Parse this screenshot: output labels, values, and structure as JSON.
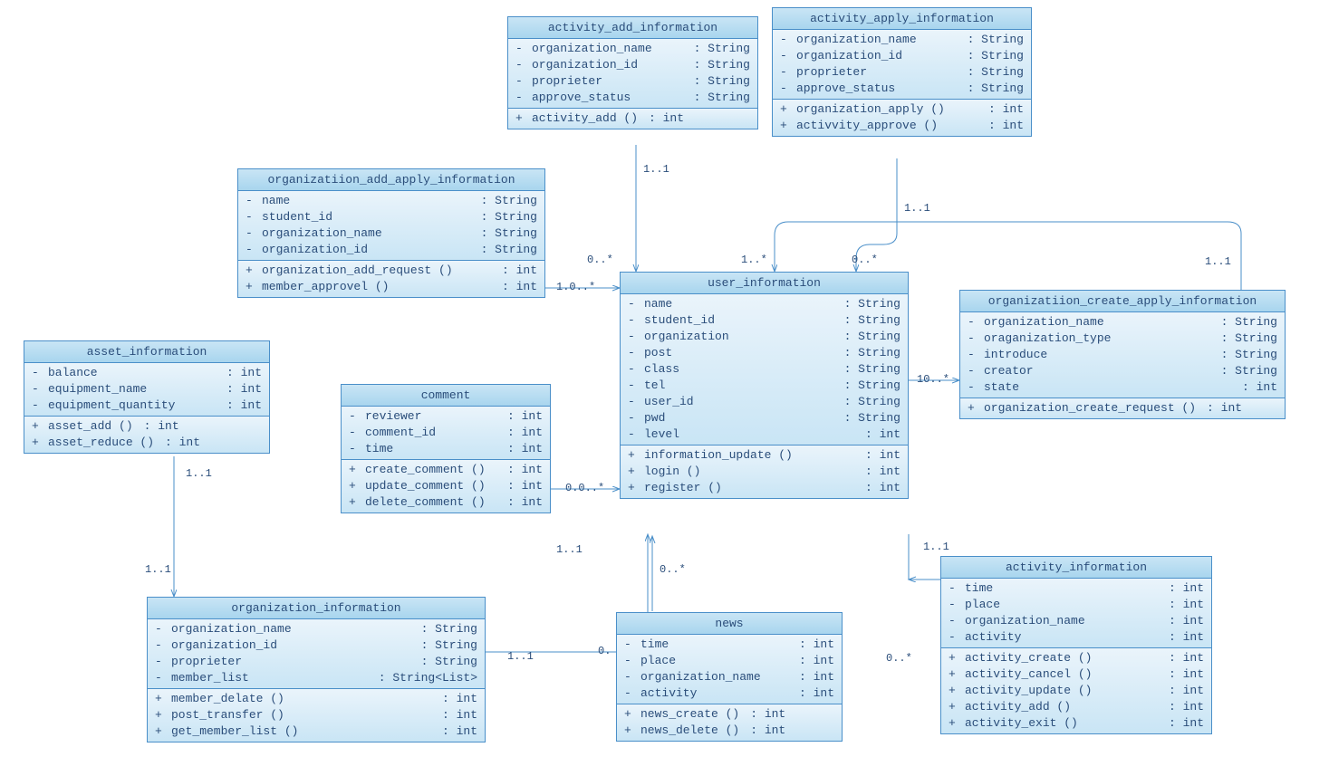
{
  "classes": {
    "activity_add_information": {
      "title": "activity_add_information",
      "attrs": [
        {
          "vis": "-",
          "name": "organization_name",
          "type": ": String"
        },
        {
          "vis": "-",
          "name": "organization_id",
          "type": ": String"
        },
        {
          "vis": "-",
          "name": "proprieter",
          "type": ": String"
        },
        {
          "vis": "-",
          "name": "approve_status",
          "type": ": String"
        }
      ],
      "ops": [
        {
          "vis": "+",
          "name": "activity_add ()",
          "type": ": int"
        }
      ]
    },
    "activity_apply_information": {
      "title": "activity_apply_information",
      "attrs": [
        {
          "vis": "-",
          "name": "organization_name",
          "type": ": String"
        },
        {
          "vis": "-",
          "name": "organization_id",
          "type": ": String"
        },
        {
          "vis": "-",
          "name": "proprieter",
          "type": ": String"
        },
        {
          "vis": "-",
          "name": "approve_status",
          "type": ": String"
        }
      ],
      "ops": [
        {
          "vis": "+",
          "name": "organization_apply ()",
          "type": ": int"
        },
        {
          "vis": "+",
          "name": "activvity_approve ()",
          "type": ": int"
        }
      ]
    },
    "organizatiion_add_apply_information": {
      "title": "organizatiion_add_apply_information",
      "attrs": [
        {
          "vis": "-",
          "name": "name",
          "type": ": String"
        },
        {
          "vis": "-",
          "name": "student_id",
          "type": ": String"
        },
        {
          "vis": "-",
          "name": "organization_name",
          "type": ": String"
        },
        {
          "vis": "-",
          "name": "organization_id",
          "type": ": String"
        }
      ],
      "ops": [
        {
          "vis": "+",
          "name": "organization_add_request ()",
          "type": ": int"
        },
        {
          "vis": "+",
          "name": "member_approvel ()",
          "type": ": int"
        }
      ]
    },
    "asset_information": {
      "title": "asset_information",
      "attrs": [
        {
          "vis": "-",
          "name": "balance",
          "type": ": int"
        },
        {
          "vis": "-",
          "name": "equipment_name",
          "type": ": int"
        },
        {
          "vis": "-",
          "name": "equipment_quantity",
          "type": ": int"
        }
      ],
      "ops": [
        {
          "vis": "+",
          "name": "asset_add ()",
          "type": ": int"
        },
        {
          "vis": "+",
          "name": "asset_reduce ()",
          "type": ": int"
        }
      ]
    },
    "comment": {
      "title": "comment",
      "attrs": [
        {
          "vis": "-",
          "name": "reviewer",
          "type": ": int"
        },
        {
          "vis": "-",
          "name": "comment_id",
          "type": ": int"
        },
        {
          "vis": "-",
          "name": "time",
          "type": ": int"
        }
      ],
      "ops": [
        {
          "vis": "+",
          "name": "create_comment ()",
          "type": ": int"
        },
        {
          "vis": "+",
          "name": "update_comment ()",
          "type": ": int"
        },
        {
          "vis": "+",
          "name": "delete_comment ()",
          "type": ": int"
        }
      ]
    },
    "user_information": {
      "title": "user_information",
      "attrs": [
        {
          "vis": "-",
          "name": "name",
          "type": ": String"
        },
        {
          "vis": "-",
          "name": "student_id",
          "type": ": String"
        },
        {
          "vis": "-",
          "name": "organization",
          "type": ": String"
        },
        {
          "vis": "-",
          "name": "post",
          "type": ": String"
        },
        {
          "vis": "-",
          "name": "class",
          "type": ": String"
        },
        {
          "vis": "-",
          "name": "tel",
          "type": ": String"
        },
        {
          "vis": "-",
          "name": "user_id",
          "type": ": String"
        },
        {
          "vis": "-",
          "name": "pwd",
          "type": ": String"
        },
        {
          "vis": "-",
          "name": "level",
          "type": ": int"
        }
      ],
      "ops": [
        {
          "vis": "+",
          "name": "information_update ()",
          "type": ": int"
        },
        {
          "vis": "+",
          "name": "login ()",
          "type": ": int"
        },
        {
          "vis": "+",
          "name": "register ()",
          "type": ": int"
        }
      ]
    },
    "organizatiion_create_apply_information": {
      "title": "organizatiion_create_apply_information",
      "attrs": [
        {
          "vis": "-",
          "name": "organization_name",
          "type": ": String"
        },
        {
          "vis": "-",
          "name": "oraganization_type",
          "type": ": String"
        },
        {
          "vis": "-",
          "name": "introduce",
          "type": ": String"
        },
        {
          "vis": "-",
          "name": "creator",
          "type": ": String"
        },
        {
          "vis": "-",
          "name": "state",
          "type": ": int"
        }
      ],
      "ops": [
        {
          "vis": "+",
          "name": "organization_create_request ()",
          "type": ": int"
        }
      ]
    },
    "organization_information": {
      "title": "organization_information",
      "attrs": [
        {
          "vis": "-",
          "name": "organization_name",
          "type": ": String"
        },
        {
          "vis": "-",
          "name": "organization_id",
          "type": ": String"
        },
        {
          "vis": "-",
          "name": "proprieter",
          "type": ": String"
        },
        {
          "vis": "-",
          "name": "member_list",
          "type": ": String<List>"
        }
      ],
      "ops": [
        {
          "vis": "+",
          "name": "member_delate ()",
          "type": ": int"
        },
        {
          "vis": "+",
          "name": "post_transfer ()",
          "type": ": int"
        },
        {
          "vis": "+",
          "name": "get_member_list ()",
          "type": ": int"
        }
      ]
    },
    "news": {
      "title": "news",
      "attrs": [
        {
          "vis": "-",
          "name": "time",
          "type": ": int"
        },
        {
          "vis": "-",
          "name": "place",
          "type": ": int"
        },
        {
          "vis": "-",
          "name": "organization_name",
          "type": ": int"
        },
        {
          "vis": "-",
          "name": "activity",
          "type": ": int"
        }
      ],
      "ops": [
        {
          "vis": "+",
          "name": "news_create ()",
          "type": ": int"
        },
        {
          "vis": "+",
          "name": "news_delete ()",
          "type": ": int"
        }
      ]
    },
    "activity_information": {
      "title": "activity_information",
      "attrs": [
        {
          "vis": "-",
          "name": "time",
          "type": ": int"
        },
        {
          "vis": "-",
          "name": "place",
          "type": ": int"
        },
        {
          "vis": "-",
          "name": "organization_name",
          "type": ": int"
        },
        {
          "vis": "-",
          "name": "activity",
          "type": ": int"
        }
      ],
      "ops": [
        {
          "vis": "+",
          "name": "activity_create ()",
          "type": ": int"
        },
        {
          "vis": "+",
          "name": "activity_cancel ()",
          "type": ": int"
        },
        {
          "vis": "+",
          "name": "activity_update ()",
          "type": ": int"
        },
        {
          "vis": "+",
          "name": "activity_add ()",
          "type": ": int"
        },
        {
          "vis": "+",
          "name": "activity_exit ()",
          "type": ": int"
        }
      ]
    }
  },
  "mults": {
    "m1": "1..1",
    "m2": "0..*",
    "m3": "1..*",
    "m4": "1.0..*",
    "m5": "0.0..*",
    "m6": "10..*",
    "m7": "0.",
    "m8": "1..1",
    "m9": "1..1",
    "m10": "1..1",
    "m11": "1..1",
    "m12": "0..*",
    "m13": "1..1",
    "m14": "0..*",
    "m15": "1..1",
    "m16": "0..*",
    "m17": "1..1"
  }
}
